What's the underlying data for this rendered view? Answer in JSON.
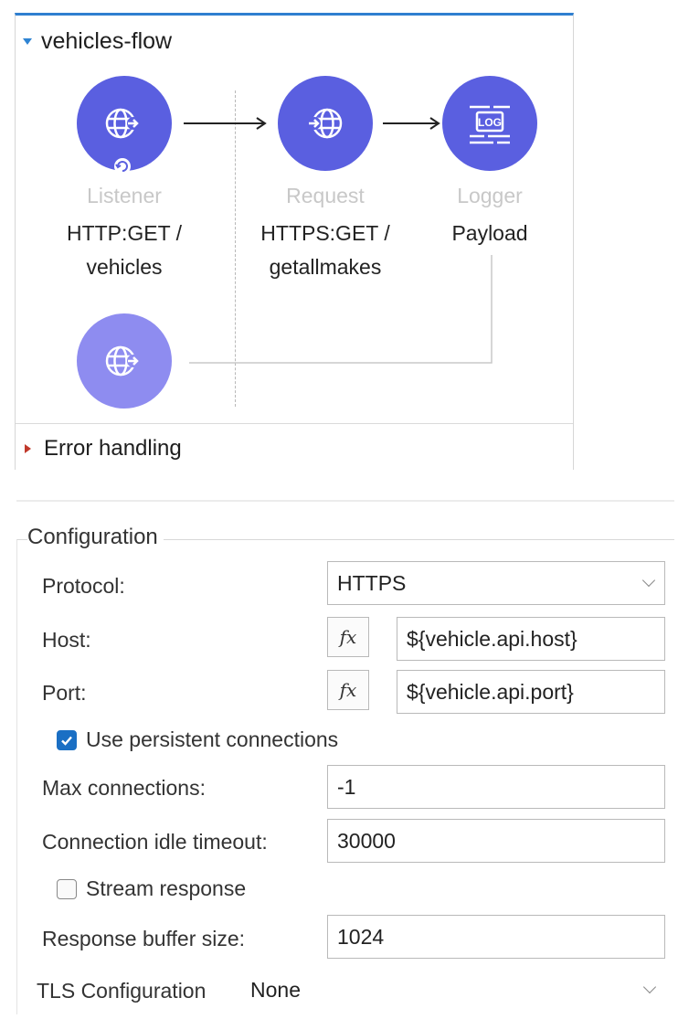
{
  "flow": {
    "name": "vehicles-flow",
    "nodes": [
      {
        "title": "Listener",
        "line1": "HTTP:GET /",
        "line2": "vehicles",
        "icon": "globe-in-icon"
      },
      {
        "title": "Request",
        "line1": "HTTPS:GET /",
        "line2": "getallmakes",
        "icon": "globe-in-icon"
      },
      {
        "title": "Logger",
        "line1": "Payload",
        "line2": "",
        "icon": "log-icon",
        "icon_text": "LOG"
      }
    ],
    "response_node_icon": "globe-out-icon",
    "error_handling_label": "Error handling"
  },
  "config": {
    "title": "Configuration",
    "protocol": {
      "label": "Protocol:",
      "value": "HTTPS"
    },
    "host": {
      "label": "Host:",
      "fx": "fx",
      "value": "${vehicle.api.host}"
    },
    "port": {
      "label": "Port:",
      "fx": "fx",
      "value": "${vehicle.api.port}"
    },
    "persistent": {
      "label": "Use persistent connections",
      "checked": true
    },
    "max_connections": {
      "label": "Max connections:",
      "value": "-1"
    },
    "idle_timeout": {
      "label": "Connection idle timeout:",
      "value": "30000"
    },
    "stream_response": {
      "label": "Stream response",
      "checked": false
    },
    "buffer_size": {
      "label": "Response buffer size:",
      "value": "1024"
    },
    "tls": {
      "label": "TLS Configuration",
      "value": "None"
    }
  },
  "colors": {
    "node": "#5a5fe0",
    "node_faded": "#8e8cf0",
    "accent": "#2f7fd0",
    "checkbox": "#1a6fc4"
  }
}
